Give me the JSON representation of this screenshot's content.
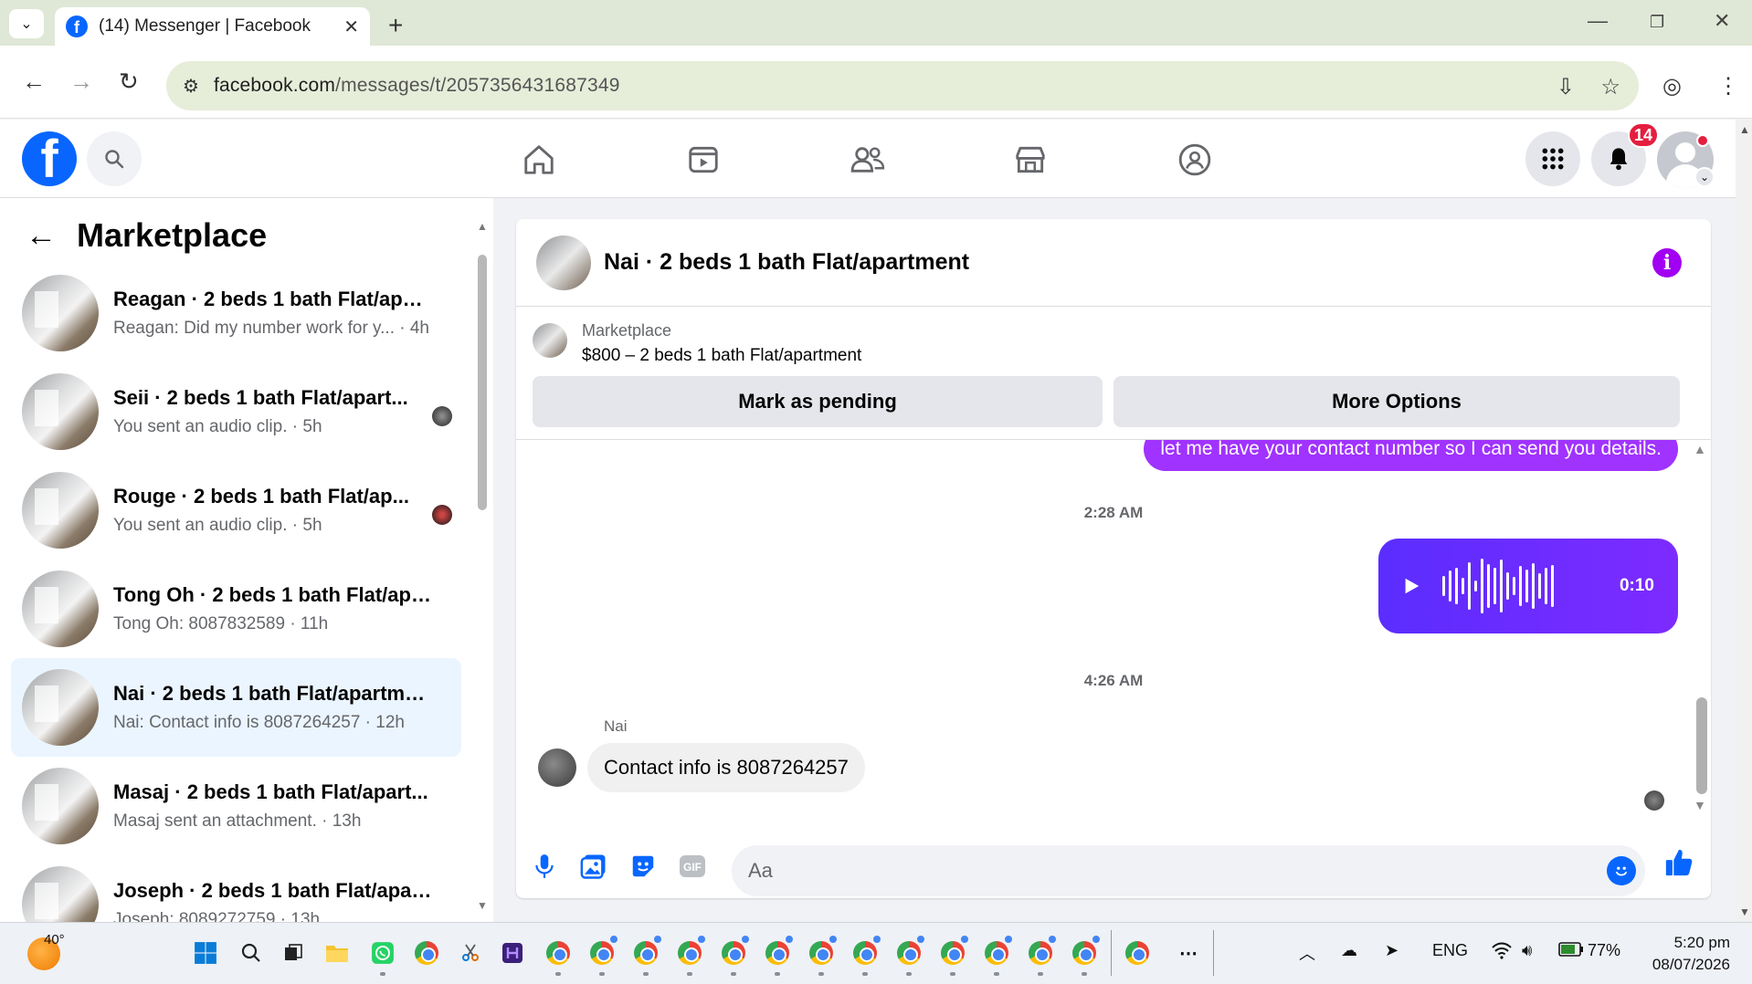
{
  "browser": {
    "tab_title": "(14) Messenger | Facebook",
    "url_domain": "facebook.com",
    "url_path": "/messages/t/2057356431687349"
  },
  "facebook": {
    "notification_count": "14"
  },
  "sidebar": {
    "title": "Marketplace",
    "conversations": [
      {
        "name": "Reagan · 2 beds 1 bath Flat/apar...",
        "preview": "Reagan: Did my number work for y... · 4h",
        "active": false,
        "seen": ""
      },
      {
        "name": "Seii · 2 beds 1 bath Flat/apart...",
        "preview": "You sent an audio clip. · 5h",
        "active": false,
        "seen": "gray"
      },
      {
        "name": "Rouge · 2 beds 1 bath Flat/ap...",
        "preview": "You sent an audio clip. · 5h",
        "active": false,
        "seen": "red"
      },
      {
        "name": "Tong Oh · 2 beds 1 bath Flat/apa...",
        "preview": "Tong Oh: 8087832589 · 11h",
        "active": false,
        "seen": ""
      },
      {
        "name": "Nai · 2 beds 1 bath Flat/apartment",
        "preview": "Nai: Contact info is 8087264257 · 12h",
        "active": true,
        "seen": ""
      },
      {
        "name": "Masaj · 2 beds 1 bath Flat/apart...",
        "preview": "Masaj sent an attachment. · 13h",
        "active": false,
        "seen": ""
      },
      {
        "name": "Joseph · 2 beds 1 bath Flat/apart...",
        "preview": "Joseph: 8089272759 · 13h",
        "active": false,
        "seen": ""
      }
    ]
  },
  "chat": {
    "title": "Nai · 2 beds 1 bath Flat/apartment",
    "marketplace_label": "Marketplace",
    "listing": "$800 – 2 beds 1 bath Flat/apartment",
    "mark_pending": "Mark as pending",
    "more_options": "More Options",
    "messages": {
      "outgoing_partial": "let me have your contact number so I can send you details.",
      "time1": "2:28 AM",
      "audio_duration": "0:10",
      "time2": "4:26 AM",
      "sender": "Nai",
      "incoming": "Contact info is 8087264257"
    },
    "composer_placeholder": "Aa"
  },
  "taskbar": {
    "temperature": "40°",
    "language": "ENG",
    "battery": "77%",
    "time": "5:20 pm",
    "date": "08/07/2026"
  },
  "colors": {
    "fb_blue": "#0866ff",
    "messenger_purple": "#a033ff",
    "audio_gradient_start": "#5b2dff",
    "notif_red": "#e41e3f"
  }
}
